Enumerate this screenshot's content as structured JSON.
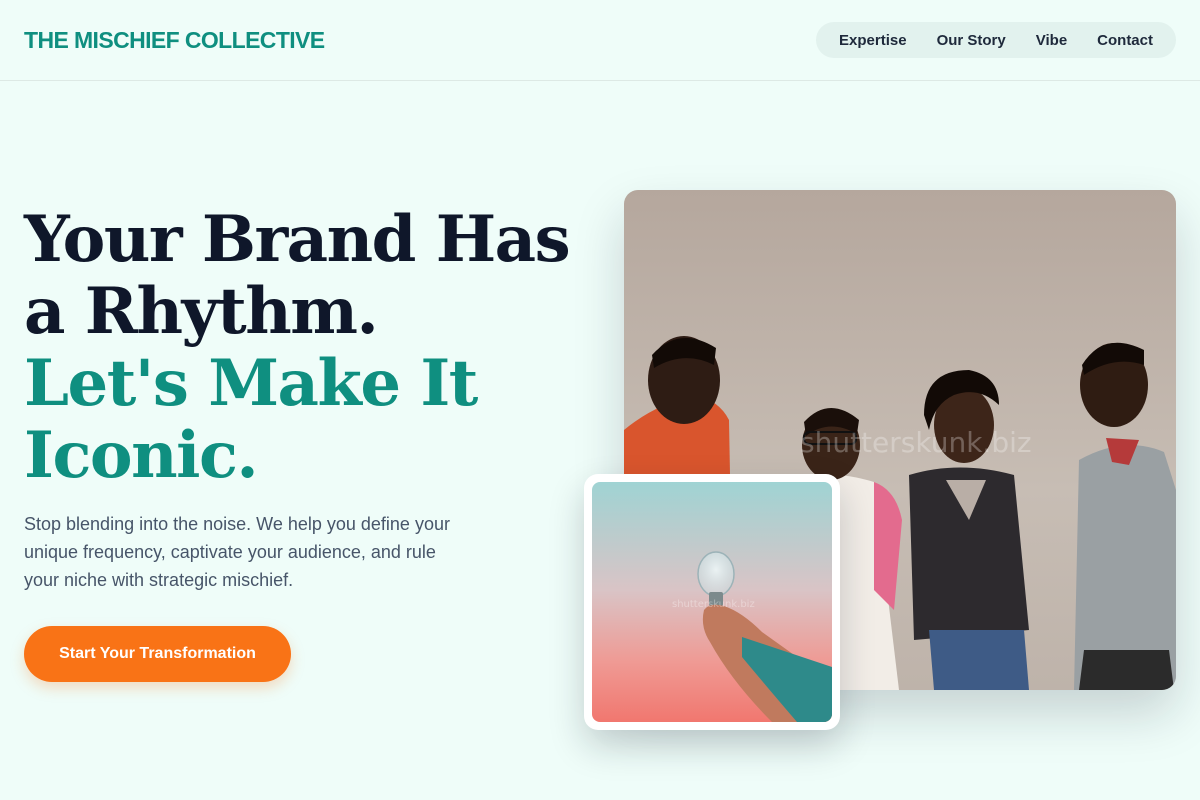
{
  "brand": {
    "name": "THE MISCHIEF COLLECTIVE"
  },
  "nav": {
    "items": [
      {
        "label": "Expertise"
      },
      {
        "label": "Our Story"
      },
      {
        "label": "Vibe"
      },
      {
        "label": "Contact"
      }
    ]
  },
  "hero": {
    "headline_lines": [
      "Your Brand Has",
      "a Rhythm."
    ],
    "accent_lines": [
      "Let's Make It",
      "Iconic."
    ],
    "subtext": "Stop blending into the noise. We help you define your unique frequency, captivate your audience, and rule your niche with strategic mischief.",
    "cta_label": "Start Your Transformation"
  },
  "images": {
    "main_watermark": "shutterskunk.biz",
    "inset_watermark": "shutterskunk.biz"
  },
  "colors": {
    "accent": "#0f8f80",
    "cta": "#f97316",
    "background": "#effdf9",
    "text": "#0f172a"
  }
}
